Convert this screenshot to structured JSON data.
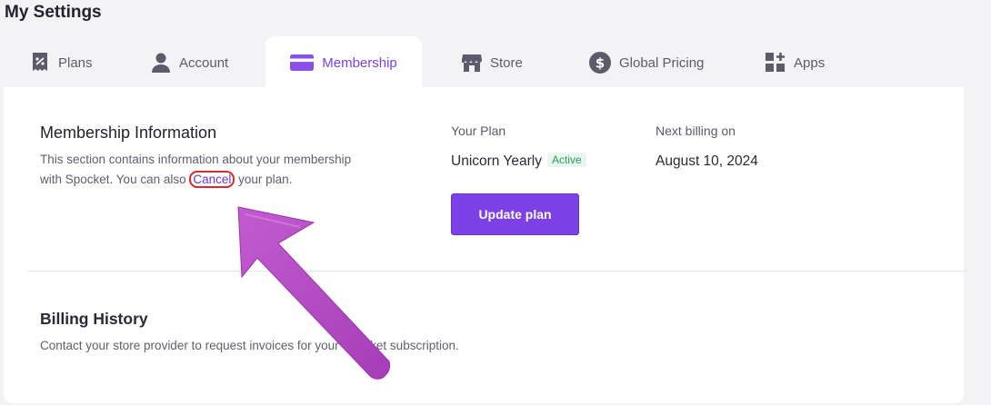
{
  "page": {
    "title": "My Settings"
  },
  "tabs": [
    {
      "label": "Plans",
      "icon": "receipt-icon"
    },
    {
      "label": "Account",
      "icon": "user-icon"
    },
    {
      "label": "Membership",
      "icon": "credit-card-icon"
    },
    {
      "label": "Store",
      "icon": "storefront-icon"
    },
    {
      "label": "Global Pricing",
      "icon": "dollar-circle-icon"
    },
    {
      "label": "Apps",
      "icon": "apps-grid-plus-icon"
    }
  ],
  "membership": {
    "title": "Membership Information",
    "desc_line1": "This section contains information about your membership",
    "desc_line2_before": "with Spocket. You can also ",
    "cancel_link": "Cancel",
    "desc_line2_after": " your plan.",
    "your_plan_label": "Your Plan",
    "plan_name": "Unicorn Yearly",
    "plan_status": "Active",
    "next_billing_label": "Next billing on",
    "next_billing_date": "August 10, 2024",
    "update_button": "Update plan"
  },
  "billing": {
    "title": "Billing History",
    "desc": "Contact your store provider to request invoices for your Spocket subscription."
  },
  "colors": {
    "accent": "#7d3fe6",
    "active_badge_bg": "#e9f7ee",
    "active_badge_text": "#2e9d5a",
    "annotation_arrow": "#b84fc6",
    "annotation_circle": "#d42b2b"
  }
}
